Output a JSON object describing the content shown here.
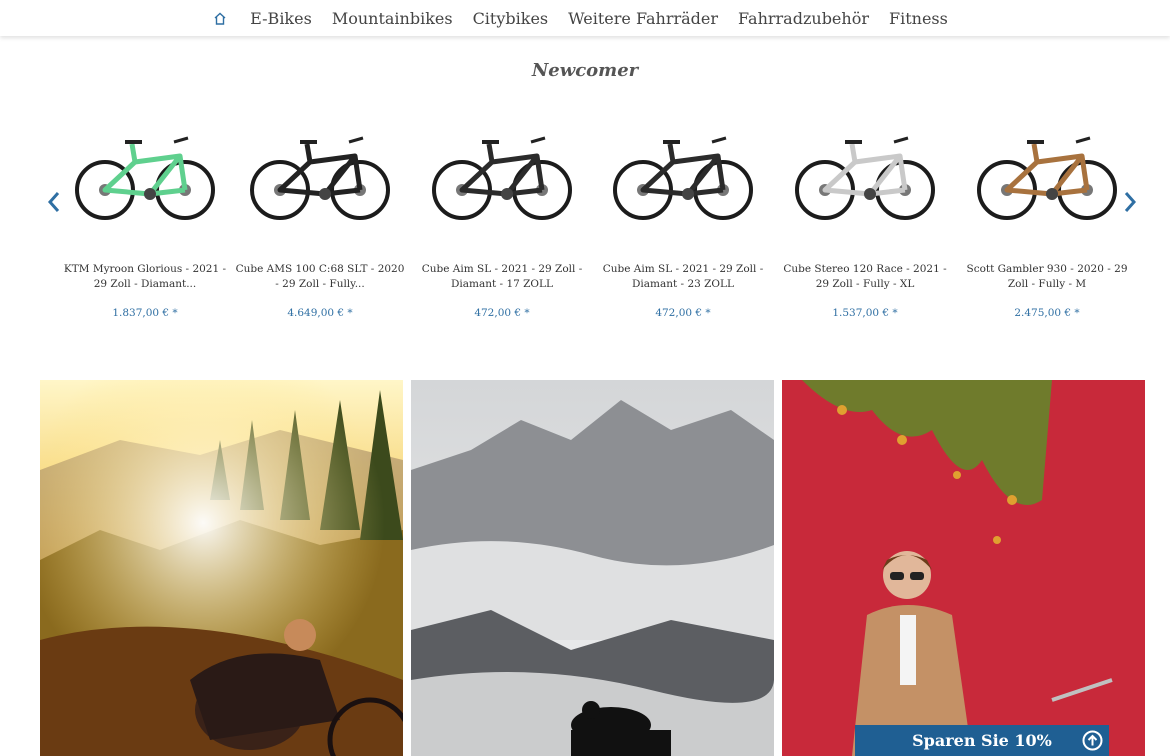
{
  "nav": {
    "home_icon": "home-icon",
    "items": [
      "E-Bikes",
      "Mountainbikes",
      "Citybikes",
      "Weitere Fahrräder",
      "Fahrradzubehör",
      "Fitness"
    ]
  },
  "section_title": "Newcomer",
  "products": [
    {
      "name": "KTM Myroon Glorious - 2021 - 29 Zoll - Diamant...",
      "price": "1.837,00 € *",
      "frame_color": "#5fd08e"
    },
    {
      "name": "Cube AMS 100 C:68 SLT - 2020 - 29 Zoll - Fully...",
      "price": "4.649,00 € *",
      "frame_color": "#222222"
    },
    {
      "name": "Cube Aim SL - 2021 - 29 Zoll - Diamant - 17 ZOLL",
      "price": "472,00 € *",
      "frame_color": "#2b2b2b"
    },
    {
      "name": "Cube Aim SL - 2021 - 29 Zoll - Diamant - 23 ZOLL",
      "price": "472,00 € *",
      "frame_color": "#2b2b2b"
    },
    {
      "name": "Cube Stereo 120 Race - 2021 - 29 Zoll - Fully - XL",
      "price": "1.537,00 € *",
      "frame_color": "#c9c9c9"
    },
    {
      "name": "Scott Gambler 930 - 2020 - 29 Zoll - Fully - M",
      "price": "2.475,00 € *",
      "frame_color": "#a8723e"
    }
  ],
  "slider": {
    "prev_icon": "chevron-left-icon",
    "next_icon": "chevron-right-icon"
  },
  "sparen_label": "Sparen Sie 10%",
  "colors": {
    "accent": "#1f5f93",
    "price": "#2f6fa3",
    "arrow": "#2f6fa3"
  }
}
